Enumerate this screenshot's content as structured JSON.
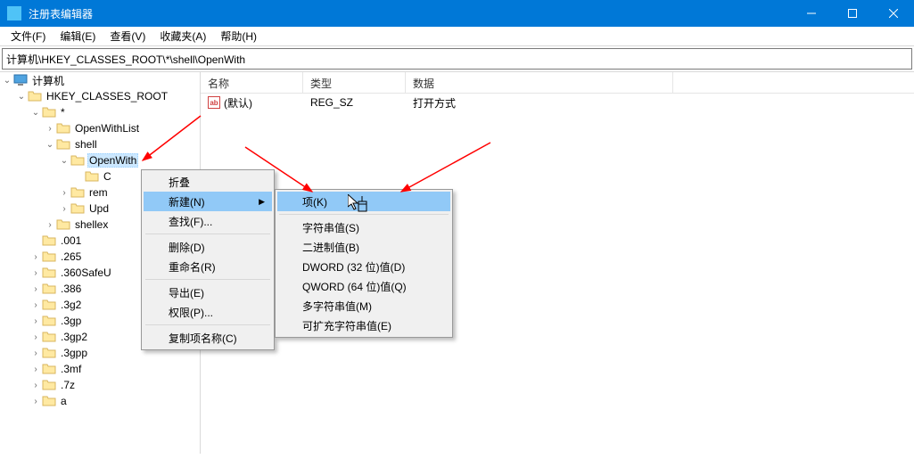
{
  "window": {
    "title": "注册表编辑器"
  },
  "menubar": [
    {
      "label": "文件(F)"
    },
    {
      "label": "编辑(E)"
    },
    {
      "label": "查看(V)"
    },
    {
      "label": "收藏夹(A)"
    },
    {
      "label": "帮助(H)"
    }
  ],
  "address": "计算机\\HKEY_CLASSES_ROOT\\*\\shell\\OpenWith",
  "tree": {
    "root_label": "计算机",
    "hkcr": "HKEY_CLASSES_ROOT",
    "star": "*",
    "openwithlist": "OpenWithList",
    "shell": "shell",
    "openwith": "OpenWith",
    "child_c": "C",
    "remove": "rem",
    "update": "Upd",
    "shellex": "shellex",
    "items001": ".001",
    "items265": ".265",
    "items360safe": ".360SafeU",
    "items386": ".386",
    "items3g2": ".3g2",
    "items3gp": ".3gp",
    "items3gp2": ".3gp2",
    "items3gpp": ".3gpp",
    "items3mf": ".3mf",
    "items7z": ".7z",
    "itemsa": "a"
  },
  "columns": {
    "name": "名称",
    "type": "类型",
    "data": "数据"
  },
  "col_widths": {
    "name": 115,
    "type": 115,
    "data": 300
  },
  "row": {
    "name": "(默认)",
    "type": "REG_SZ",
    "data": "打开方式"
  },
  "ctx1": {
    "collapse": "折叠",
    "new": "新建(N)",
    "find": "查找(F)...",
    "delete": "删除(D)",
    "rename": "重命名(R)",
    "export": "导出(E)",
    "perm": "权限(P)...",
    "copyname": "复制项名称(C)"
  },
  "ctx2": {
    "key": "项(K)",
    "string": "字符串值(S)",
    "binary": "二进制值(B)",
    "dword": "DWORD (32 位)值(D)",
    "qword": "QWORD (64 位)值(Q)",
    "multi": "多字符串值(M)",
    "expand": "可扩充字符串值(E)"
  }
}
